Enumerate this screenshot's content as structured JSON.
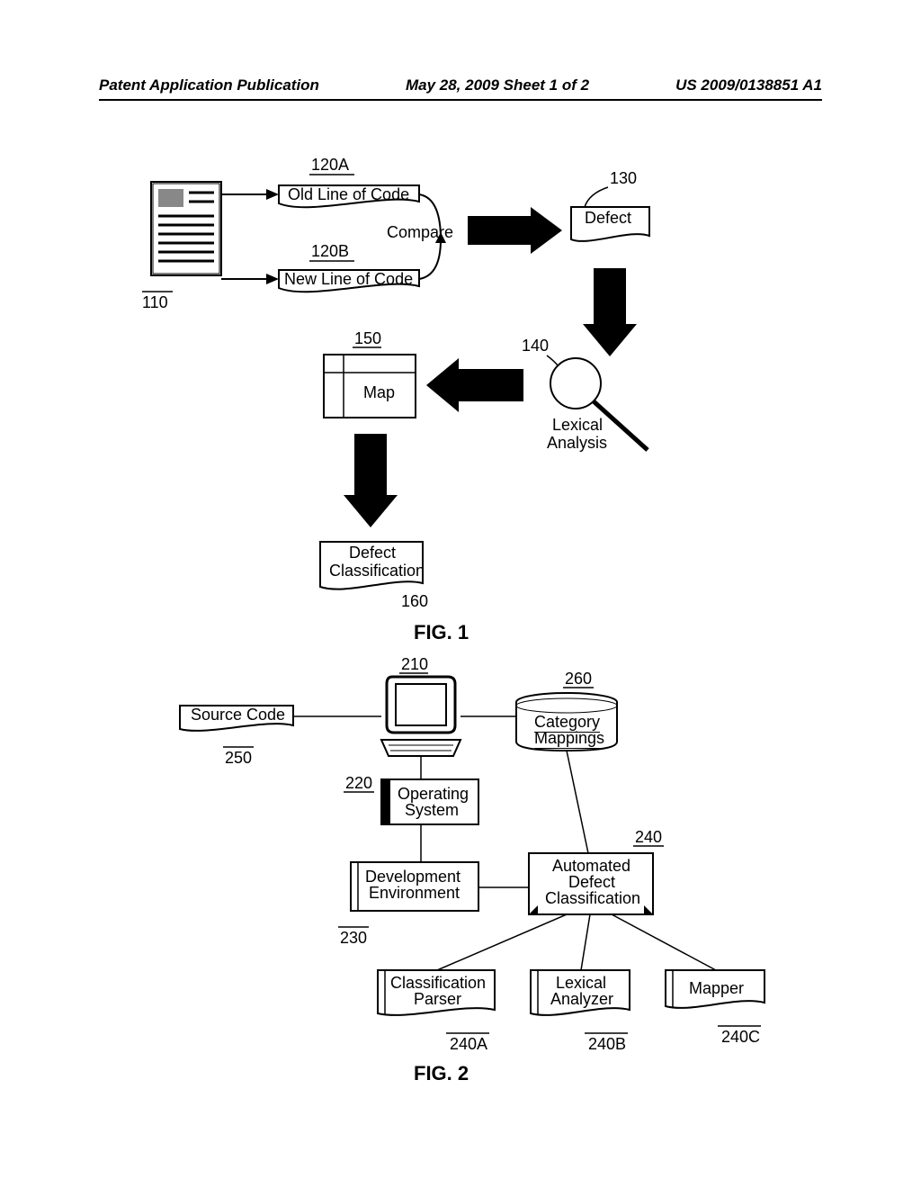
{
  "header": {
    "left": "Patent Application Publication",
    "center": "May 28, 2009  Sheet 1 of 2",
    "right": "US 2009/0138851 A1"
  },
  "fig1": {
    "title": "FIG. 1",
    "nodes": {
      "source_doc": {
        "ref": "110"
      },
      "old_line": {
        "label": "Old Line of Code",
        "ref": "120A"
      },
      "new_line": {
        "label": "New Line of Code",
        "ref": "120B"
      },
      "compare": {
        "label": "Compare"
      },
      "defect": {
        "label": "Defect",
        "ref": "130"
      },
      "lexical": {
        "label1": "Lexical",
        "label2": "Analysis",
        "ref": "140"
      },
      "map": {
        "label": "Map",
        "ref": "150"
      },
      "classification": {
        "label1": "Defect",
        "label2": "Classification",
        "ref": "160"
      }
    }
  },
  "fig2": {
    "title": "FIG. 2",
    "nodes": {
      "source_code": {
        "label": "Source Code",
        "ref": "250"
      },
      "computer": {
        "ref": "210"
      },
      "category_mappings": {
        "label1": "Category",
        "label2": "Mappings",
        "ref": "260"
      },
      "os": {
        "label1": "Operating",
        "label2": "System",
        "ref": "220"
      },
      "dev_env": {
        "label1": "Development",
        "label2": "Environment",
        "ref": "230"
      },
      "adc": {
        "label1": "Automated",
        "label2": "Defect",
        "label3": "Classification",
        "ref": "240"
      },
      "parser": {
        "label1": "Classification",
        "label2": "Parser",
        "ref": "240A"
      },
      "lex_analyzer": {
        "label1": "Lexical",
        "label2": "Analyzer",
        "ref": "240B"
      },
      "mapper": {
        "label": "Mapper",
        "ref": "240C"
      }
    }
  }
}
